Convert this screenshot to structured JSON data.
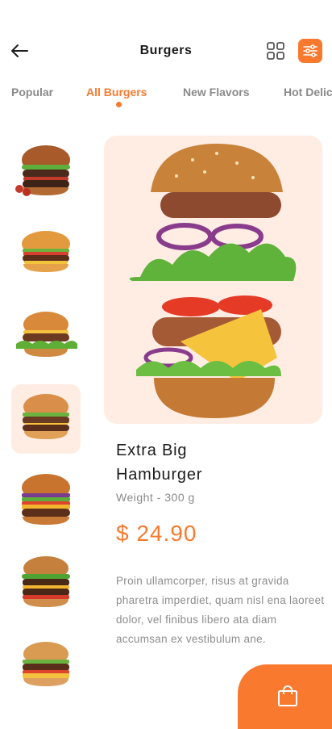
{
  "header": {
    "title": "Burgers"
  },
  "tabs": [
    {
      "label": "Popular",
      "active": false
    },
    {
      "label": "All Burgers",
      "active": true
    },
    {
      "label": "New Flavors",
      "active": false
    },
    {
      "label": "Hot Delicious",
      "active": false
    }
  ],
  "thumbnails": [
    {
      "name": "burger-thumb-1",
      "selected": false
    },
    {
      "name": "burger-thumb-2",
      "selected": false
    },
    {
      "name": "burger-thumb-3",
      "selected": false
    },
    {
      "name": "burger-thumb-4",
      "selected": true
    },
    {
      "name": "burger-thumb-5",
      "selected": false
    },
    {
      "name": "burger-thumb-6",
      "selected": false
    },
    {
      "name": "burger-thumb-7",
      "selected": false
    }
  ],
  "product": {
    "name_line1": "Extra Big",
    "name_line2": "Hamburger",
    "weight": "Weight - 300 g",
    "price": "$ 24.90",
    "description": "Proin ullamcorper, risus at gravida pharetra imperdiet, quam nisl ena laoreet dolor, vel finibus libero ata diam accumsan ex vestibulum ane."
  },
  "colors": {
    "accent": "#F97A2E",
    "card_bg": "#FFEDE4"
  },
  "icons": {
    "back": "arrow-left-icon",
    "grid": "grid-icon",
    "filter": "sliders-icon",
    "cart": "shopping-bag-icon"
  }
}
